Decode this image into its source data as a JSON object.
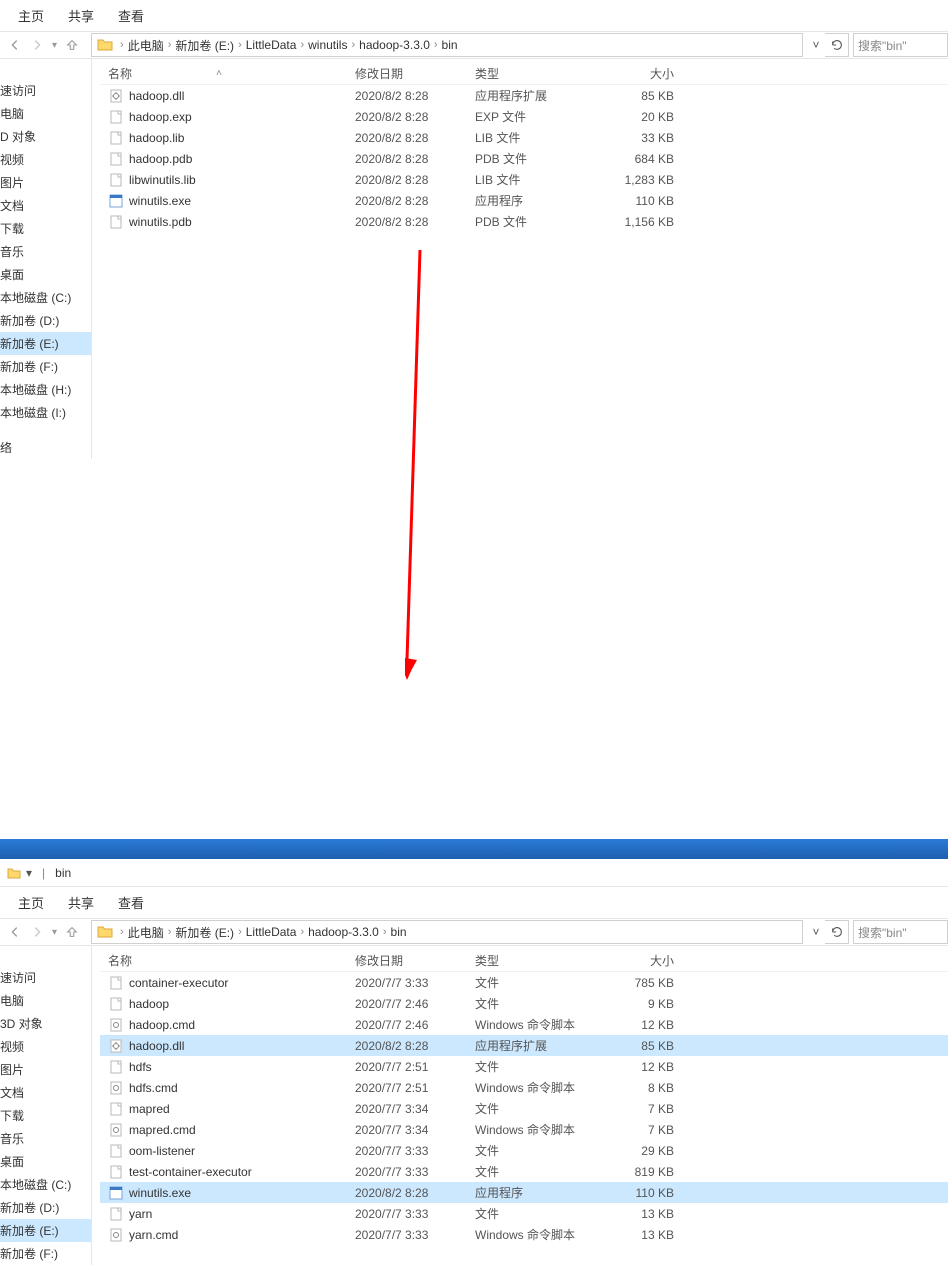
{
  "arrow_color": "#ff0000",
  "window_top": {
    "tabs": {
      "home": "主页",
      "share": "共享",
      "view": "查看"
    },
    "breadcrumb": {
      "pc": "此电脑",
      "vol": "新加卷 (E:)",
      "d1": "LittleData",
      "d2": "winutils",
      "d3": "hadoop-3.3.0",
      "d4": "bin"
    },
    "search_placeholder": "搜索\"bin\"",
    "columns": {
      "name": "名称",
      "date": "修改日期",
      "type": "类型",
      "size": "大小"
    },
    "sidebar": [
      {
        "label": "速访问",
        "sel": false
      },
      {
        "label": "电脑",
        "sel": false
      },
      {
        "label": "D 对象",
        "sel": false
      },
      {
        "label": "视频",
        "sel": false
      },
      {
        "label": "图片",
        "sel": false
      },
      {
        "label": "文档",
        "sel": false
      },
      {
        "label": "下载",
        "sel": false
      },
      {
        "label": "音乐",
        "sel": false
      },
      {
        "label": "桌面",
        "sel": false
      },
      {
        "label": "本地磁盘 (C:)",
        "sel": false
      },
      {
        "label": "新加卷 (D:)",
        "sel": false
      },
      {
        "label": "新加卷 (E:)",
        "sel": true
      },
      {
        "label": "新加卷 (F:)",
        "sel": false
      },
      {
        "label": "本地磁盘 (H:)",
        "sel": false
      },
      {
        "label": "本地磁盘 (I:)",
        "sel": false
      },
      {
        "label": "",
        "sel": false
      },
      {
        "label": "络",
        "sel": false
      }
    ],
    "files": [
      {
        "icon": "dll",
        "name": "hadoop.dll",
        "date": "2020/8/2 8:28",
        "type": "应用程序扩展",
        "size": "85 KB"
      },
      {
        "icon": "file",
        "name": "hadoop.exp",
        "date": "2020/8/2 8:28",
        "type": "EXP 文件",
        "size": "20 KB"
      },
      {
        "icon": "file",
        "name": "hadoop.lib",
        "date": "2020/8/2 8:28",
        "type": "LIB 文件",
        "size": "33 KB"
      },
      {
        "icon": "file",
        "name": "hadoop.pdb",
        "date": "2020/8/2 8:28",
        "type": "PDB 文件",
        "size": "684 KB"
      },
      {
        "icon": "file",
        "name": "libwinutils.lib",
        "date": "2020/8/2 8:28",
        "type": "LIB 文件",
        "size": "1,283 KB"
      },
      {
        "icon": "exe",
        "name": "winutils.exe",
        "date": "2020/8/2 8:28",
        "type": "应用程序",
        "size": "110 KB"
      },
      {
        "icon": "file",
        "name": "winutils.pdb",
        "date": "2020/8/2 8:28",
        "type": "PDB 文件",
        "size": "1,156 KB"
      }
    ]
  },
  "window_bottom": {
    "title": {
      "sep": "|",
      "name": "bin"
    },
    "tabs": {
      "home": "主页",
      "share": "共享",
      "view": "查看"
    },
    "breadcrumb": {
      "pc": "此电脑",
      "vol": "新加卷 (E:)",
      "d1": "LittleData",
      "d2": "hadoop-3.3.0",
      "d3": "bin"
    },
    "search_placeholder": "搜索\"bin\"",
    "columns": {
      "name": "名称",
      "date": "修改日期",
      "type": "类型",
      "size": "大小"
    },
    "sidebar": [
      {
        "label": "速访问",
        "sel": false
      },
      {
        "label": "电脑",
        "sel": false
      },
      {
        "label": "3D 对象",
        "sel": false
      },
      {
        "label": "视频",
        "sel": false
      },
      {
        "label": "图片",
        "sel": false
      },
      {
        "label": "文档",
        "sel": false
      },
      {
        "label": "下载",
        "sel": false
      },
      {
        "label": "音乐",
        "sel": false
      },
      {
        "label": "桌面",
        "sel": false
      },
      {
        "label": "本地磁盘 (C:)",
        "sel": false
      },
      {
        "label": "新加卷 (D:)",
        "sel": false
      },
      {
        "label": "新加卷 (E:)",
        "sel": true
      },
      {
        "label": "新加卷 (F:)",
        "sel": false
      }
    ],
    "files": [
      {
        "sel": false,
        "icon": "file",
        "name": "container-executor",
        "date": "2020/7/7 3:33",
        "type": "文件",
        "size": "785 KB"
      },
      {
        "sel": false,
        "icon": "file",
        "name": "hadoop",
        "date": "2020/7/7 2:46",
        "type": "文件",
        "size": "9 KB"
      },
      {
        "sel": false,
        "icon": "cmd",
        "name": "hadoop.cmd",
        "date": "2020/7/7 2:46",
        "type": "Windows 命令脚本",
        "size": "12 KB"
      },
      {
        "sel": true,
        "icon": "dll",
        "name": "hadoop.dll",
        "date": "2020/8/2 8:28",
        "type": "应用程序扩展",
        "size": "85 KB"
      },
      {
        "sel": false,
        "icon": "file",
        "name": "hdfs",
        "date": "2020/7/7 2:51",
        "type": "文件",
        "size": "12 KB"
      },
      {
        "sel": false,
        "icon": "cmd",
        "name": "hdfs.cmd",
        "date": "2020/7/7 2:51",
        "type": "Windows 命令脚本",
        "size": "8 KB"
      },
      {
        "sel": false,
        "icon": "file",
        "name": "mapred",
        "date": "2020/7/7 3:34",
        "type": "文件",
        "size": "7 KB"
      },
      {
        "sel": false,
        "icon": "cmd",
        "name": "mapred.cmd",
        "date": "2020/7/7 3:34",
        "type": "Windows 命令脚本",
        "size": "7 KB"
      },
      {
        "sel": false,
        "icon": "file",
        "name": "oom-listener",
        "date": "2020/7/7 3:33",
        "type": "文件",
        "size": "29 KB"
      },
      {
        "sel": false,
        "icon": "file",
        "name": "test-container-executor",
        "date": "2020/7/7 3:33",
        "type": "文件",
        "size": "819 KB"
      },
      {
        "sel": true,
        "icon": "exe",
        "name": "winutils.exe",
        "date": "2020/8/2 8:28",
        "type": "应用程序",
        "size": "110 KB"
      },
      {
        "sel": false,
        "icon": "file",
        "name": "yarn",
        "date": "2020/7/7 3:33",
        "type": "文件",
        "size": "13 KB"
      },
      {
        "sel": false,
        "icon": "cmd",
        "name": "yarn.cmd",
        "date": "2020/7/7 3:33",
        "type": "Windows 命令脚本",
        "size": "13 KB"
      }
    ]
  }
}
